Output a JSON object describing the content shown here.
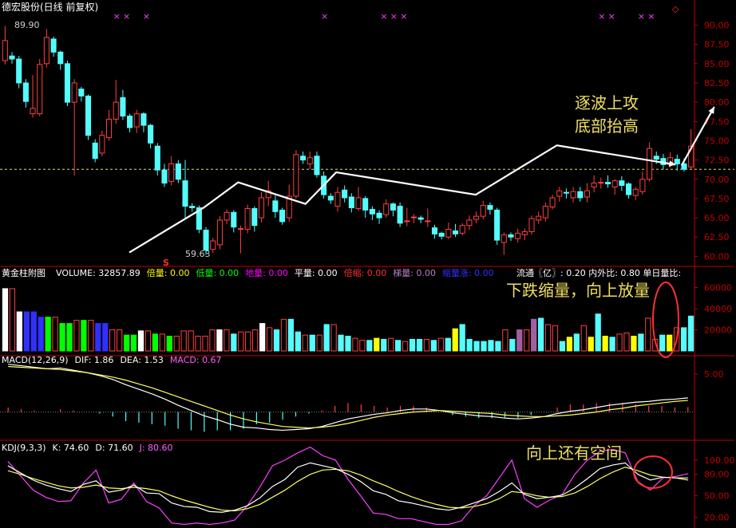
{
  "header": {
    "main_title": "德宏股份(日线 前复权)",
    "volume_title": "黄金柱附图",
    "volume_items": [
      {
        "label": "VOLUME:",
        "value": "32857.89",
        "color": "#ffffff"
      },
      {
        "label": "倍量:",
        "value": "0.00",
        "color": "#ffff00"
      },
      {
        "label": "低量:",
        "value": "0.00",
        "color": "#00ff00"
      },
      {
        "label": "地量:",
        "value": "0.00",
        "color": "#ff00ff"
      },
      {
        "label": "平量:",
        "value": "0.00",
        "color": "#ffffff"
      },
      {
        "label": "倍缩:",
        "value": "0.00",
        "color": "#ff3030"
      },
      {
        "label": "梯量:",
        "value": "0.00",
        "color": "#b080c0"
      },
      {
        "label": "缩量涨:",
        "value": "0.00",
        "color": "#3030ff"
      }
    ],
    "volume_right": "流通〖亿〗: 0.20  内外比: 0.80  单日量比:",
    "macd_items": [
      {
        "label": "MACD(12,26,9)",
        "value": "",
        "color": "#ffffff"
      },
      {
        "label": "DIF:",
        "value": "1.86",
        "color": "#ffffff"
      },
      {
        "label": "DEA:",
        "value": "1.53",
        "color": "#ffffff"
      },
      {
        "label": "MACD:",
        "value": "0.67",
        "color": "#ff60ff"
      }
    ],
    "kdj_items": [
      {
        "label": "KDJ(9,3,3)",
        "value": "",
        "color": "#ffffff"
      },
      {
        "label": "K:",
        "value": "74.60",
        "color": "#ffffff"
      },
      {
        "label": "D:",
        "value": "71.60",
        "color": "#ffffff"
      },
      {
        "label": "J:",
        "value": "80.60",
        "color": "#ff60ff"
      }
    ]
  },
  "annotations": {
    "line1": "逐波上攻",
    "line2": "底部抬高",
    "volume_note": "下跌缩量，向上放量",
    "kdj_note": "向上还有空间",
    "high_label": "89.90",
    "low_label": "59.63",
    "s_marker": "S",
    "x_marker": "×",
    "corner_marker": "◇"
  },
  "colors": {
    "up": "#ff4040",
    "down": "#54fcfc",
    "axis": "#c00000",
    "dashed_level": "#e0e060",
    "white": "#ffffff",
    "yellow": "#ffff00",
    "green": "#00ff00",
    "blue": "#3030ff",
    "purple": "#a060a0",
    "magenta": "#ff40ff",
    "circle": "#ff3030"
  },
  "chart_data": {
    "type": "candlestick",
    "price_axis": {
      "ticks": [
        "90.00",
        "87.50",
        "85.00",
        "82.50",
        "80.00",
        "77.50",
        "75.00",
        "72.50",
        "70.00",
        "67.50",
        "65.00",
        "62.50",
        "60.00"
      ],
      "ylim": [
        58.9,
        91.4
      ]
    },
    "volume_axis": {
      "ticks": [
        "60000",
        "40000",
        "20000"
      ],
      "ylim": [
        0,
        68000
      ]
    },
    "macd_axis": {
      "ticks": [
        "5.00"
      ],
      "ylim": [
        -3.3,
        7.0
      ]
    },
    "kdj_axis": {
      "ticks": [
        "100.00",
        "80.00",
        "50.00",
        "20.00"
      ],
      "ylim": [
        5,
        112
      ]
    },
    "dashed_level": 71.3,
    "x_marks": [
      11,
      12,
      14,
      32,
      38,
      39,
      40,
      60,
      61,
      64,
      65
    ],
    "candles": [
      [
        85.4,
        88.0,
        84.9,
        89.9,
        "up"
      ],
      [
        86.0,
        85.6,
        85.0,
        86.5,
        "down"
      ],
      [
        85.6,
        82.5,
        81.8,
        86.0,
        "down"
      ],
      [
        82.5,
        80.1,
        79.3,
        83.0,
        "down"
      ],
      [
        79.2,
        78.5,
        78.0,
        83.5,
        "up"
      ],
      [
        78.5,
        84.9,
        78.2,
        85.6,
        "up"
      ],
      [
        85.0,
        88.4,
        84.5,
        89.5,
        "up"
      ],
      [
        88.2,
        86.5,
        85.9,
        88.5,
        "down"
      ],
      [
        86.5,
        85.0,
        84.2,
        86.7,
        "down"
      ],
      [
        85.0,
        80.0,
        79.5,
        85.4,
        "down"
      ],
      [
        80.0,
        82.5,
        70.5,
        83.0,
        "up"
      ],
      [
        81.7,
        80.8,
        80.1,
        82.0,
        "down"
      ],
      [
        80.8,
        75.7,
        75.1,
        81.0,
        "down"
      ],
      [
        74.7,
        72.7,
        72.2,
        75.2,
        "down"
      ],
      [
        73.4,
        75.7,
        73.0,
        76.3,
        "up"
      ],
      [
        75.4,
        77.8,
        75.0,
        79.0,
        "up"
      ],
      [
        77.8,
        80.0,
        77.2,
        82.9,
        "up"
      ],
      [
        80.6,
        78.2,
        77.7,
        81.6,
        "down"
      ],
      [
        78.2,
        76.7,
        76.1,
        78.5,
        "down"
      ],
      [
        76.8,
        78.5,
        76.0,
        79.0,
        "up"
      ],
      [
        78.5,
        77.0,
        76.1,
        78.7,
        "down"
      ],
      [
        77.0,
        74.7,
        74.0,
        77.2,
        "down"
      ],
      [
        74.3,
        71.2,
        70.5,
        74.7,
        "down"
      ],
      [
        71.2,
        69.5,
        69.0,
        72.0,
        "down"
      ],
      [
        69.7,
        72.0,
        69.2,
        73.0,
        "up"
      ],
      [
        72.0,
        70.0,
        69.5,
        72.5,
        "down"
      ],
      [
        69.8,
        66.5,
        65.0,
        72.5,
        "down"
      ],
      [
        66.5,
        66.3,
        65.8,
        66.9,
        "down"
      ],
      [
        66.3,
        63.5,
        63.0,
        66.6,
        "down"
      ],
      [
        63.4,
        60.8,
        60.2,
        63.8,
        "down"
      ],
      [
        60.9,
        62.0,
        60.4,
        62.4,
        "up"
      ],
      [
        61.5,
        64.7,
        60.9,
        65.2,
        "up"
      ],
      [
        64.7,
        65.7,
        64.2,
        66.1,
        "up"
      ],
      [
        65.7,
        63.8,
        63.1,
        66.0,
        "down"
      ],
      [
        63.6,
        63.6,
        60.4,
        64.0,
        "up"
      ],
      [
        63.5,
        66.2,
        63.0,
        66.7,
        "up"
      ],
      [
        66.2,
        64.0,
        63.2,
        66.5,
        "down"
      ],
      [
        65.0,
        67.6,
        64.4,
        68.3,
        "up"
      ],
      [
        67.6,
        68.5,
        66.5,
        69.8,
        "up"
      ],
      [
        67.2,
        65.8,
        65.0,
        67.9,
        "down"
      ],
      [
        66.0,
        64.5,
        64.1,
        66.3,
        "down"
      ],
      [
        65.0,
        67.8,
        64.5,
        69.3,
        "up"
      ],
      [
        67.8,
        73.2,
        67.5,
        73.8,
        "up"
      ],
      [
        73.0,
        72.5,
        72.0,
        73.6,
        "down"
      ],
      [
        72.0,
        72.8,
        71.3,
        73.6,
        "up"
      ],
      [
        73.0,
        70.6,
        70.2,
        73.6,
        "down"
      ],
      [
        70.4,
        68.0,
        67.5,
        71.0,
        "down"
      ],
      [
        67.8,
        67.3,
        66.8,
        68.2,
        "down"
      ],
      [
        66.5,
        68.3,
        65.8,
        69.0,
        "up"
      ],
      [
        68.6,
        67.6,
        67.0,
        69.2,
        "down"
      ],
      [
        67.7,
        66.3,
        65.7,
        68.2,
        "down"
      ],
      [
        66.2,
        67.6,
        65.9,
        69.0,
        "up"
      ],
      [
        67.5,
        66.0,
        65.0,
        67.8,
        "down"
      ],
      [
        66.1,
        65.5,
        64.7,
        66.5,
        "down"
      ],
      [
        65.6,
        65.0,
        64.2,
        66.0,
        "down"
      ],
      [
        65.4,
        66.8,
        65.0,
        67.4,
        "up"
      ],
      [
        66.8,
        66.0,
        65.2,
        67.0,
        "down"
      ],
      [
        66.5,
        64.3,
        63.8,
        67.0,
        "down"
      ],
      [
        64.6,
        64.6,
        63.9,
        66.3,
        "up"
      ],
      [
        65.0,
        65.1,
        64.3,
        65.5,
        "up"
      ],
      [
        65.0,
        64.8,
        64.3,
        65.3,
        "down"
      ],
      [
        64.6,
        64.6,
        63.8,
        66.2,
        "up"
      ],
      [
        63.7,
        62.9,
        62.3,
        64.1,
        "down"
      ],
      [
        63.0,
        62.6,
        62.2,
        63.2,
        "down"
      ],
      [
        62.5,
        63.5,
        62.2,
        64.4,
        "up"
      ],
      [
        63.3,
        62.9,
        62.5,
        64.2,
        "down"
      ],
      [
        63.0,
        64.0,
        62.7,
        64.3,
        "up"
      ],
      [
        64.0,
        64.7,
        63.4,
        65.3,
        "up"
      ],
      [
        64.8,
        65.2,
        64.3,
        65.8,
        "up"
      ],
      [
        65.2,
        66.6,
        64.8,
        67.2,
        "up"
      ],
      [
        66.6,
        66.1,
        65.4,
        67.0,
        "down"
      ],
      [
        66.0,
        62.1,
        61.5,
        66.3,
        "down"
      ],
      [
        61.8,
        62.8,
        60.2,
        63.1,
        "up"
      ],
      [
        62.8,
        62.5,
        62.0,
        63.1,
        "down"
      ],
      [
        62.3,
        63.0,
        61.8,
        63.6,
        "up"
      ],
      [
        62.8,
        63.2,
        62.1,
        63.6,
        "up"
      ],
      [
        63.2,
        64.9,
        62.8,
        65.3,
        "up"
      ],
      [
        64.7,
        65.2,
        64.2,
        65.8,
        "up"
      ],
      [
        65.0,
        66.5,
        64.5,
        67.0,
        "up"
      ],
      [
        66.4,
        67.6,
        66.1,
        68.0,
        "up"
      ],
      [
        67.8,
        68.5,
        67.1,
        69.0,
        "up"
      ],
      [
        68.3,
        68.2,
        67.5,
        68.8,
        "down"
      ],
      [
        67.6,
        68.4,
        67.0,
        69.0,
        "up"
      ],
      [
        68.4,
        67.6,
        67.1,
        69.0,
        "down"
      ],
      [
        67.7,
        68.5,
        67.0,
        69.5,
        "up"
      ],
      [
        69.0,
        69.5,
        68.3,
        70.5,
        "up"
      ],
      [
        69.5,
        69.6,
        68.8,
        70.2,
        "up"
      ],
      [
        69.6,
        69.4,
        68.9,
        70.5,
        "down"
      ],
      [
        69.0,
        69.8,
        68.0,
        70.0,
        "up"
      ],
      [
        69.8,
        69.2,
        68.5,
        70.4,
        "down"
      ],
      [
        69.4,
        68.0,
        67.5,
        69.6,
        "down"
      ],
      [
        67.9,
        68.7,
        67.3,
        69.0,
        "up"
      ],
      [
        68.4,
        70.0,
        68.0,
        71.0,
        "up"
      ],
      [
        70.0,
        74.0,
        69.7,
        74.8,
        "up"
      ],
      [
        73.0,
        72.6,
        72.0,
        73.6,
        "down"
      ],
      [
        72.7,
        71.9,
        71.3,
        73.3,
        "down"
      ],
      [
        71.9,
        72.8,
        71.5,
        73.5,
        "up"
      ],
      [
        72.6,
        72.0,
        71.1,
        73.2,
        "down"
      ],
      [
        72.0,
        71.3,
        71.0,
        72.7,
        "down"
      ],
      [
        71.6,
        74.3,
        71.2,
        76.5,
        "up"
      ]
    ],
    "arrows": [
      [
        [
          12.4,
          60.5
        ],
        [
          19.9,
          66.3
        ],
        [
          23.4,
          69.6
        ],
        [
          30.2,
          66.8
        ],
        [
          33.3,
          70.9
        ],
        [
          47.4,
          68.0
        ],
        [
          55.6,
          74.4
        ],
        [
          67.6,
          71.9
        ]
      ],
      [
        [
          68.2,
          71.8
        ],
        [
          71.5,
          79.4
        ]
      ]
    ],
    "volume": {
      "values": [
        59000,
        59000,
        37000,
        37000,
        37000,
        32000,
        32000,
        32000,
        26000,
        26000,
        29000,
        29000,
        29000,
        26000,
        26000,
        20000,
        20000,
        15000,
        15000,
        19000,
        19000,
        16000,
        16000,
        14000,
        14000,
        19000,
        19000,
        14000,
        14000,
        20000,
        20000,
        20000,
        16000,
        18000,
        18000,
        20000,
        26000,
        22000,
        20000,
        30000,
        30000,
        18000,
        15000,
        15000,
        15000,
        25000,
        25000,
        15000,
        14000,
        12000,
        10000,
        10000,
        12000,
        11000,
        12000,
        10000,
        9000,
        11000,
        11000,
        11000,
        10000,
        12000,
        12000,
        21000,
        25000,
        11000,
        9000,
        9000,
        10000,
        9000,
        20000,
        11000,
        20000,
        20000,
        30000,
        31000,
        25000,
        24000,
        9000,
        13000,
        16000,
        24000,
        13000,
        35000,
        14000,
        13000,
        16000,
        17000,
        14000,
        16000,
        31000,
        11000,
        15000,
        15000,
        22000,
        22000,
        33000
      ],
      "colors": [
        "white",
        "red",
        "white",
        "blue",
        "blue",
        "blue",
        "green",
        "red",
        "green",
        "green",
        "red",
        "green",
        "red",
        "blue",
        "blue",
        "red",
        "red",
        "green",
        "green",
        "white",
        "red",
        "green",
        "red",
        "green",
        "red",
        "red",
        "red",
        "red",
        "red",
        "red",
        "white",
        "red",
        "cyan",
        "red",
        "red",
        "red",
        "white",
        "red",
        "cyan",
        "red",
        "cyan",
        "cyan",
        "red",
        "cyan",
        "red",
        "cyan",
        "red",
        "cyan",
        "cyan",
        "red",
        "red",
        "cyan",
        "yellow",
        "cyan",
        "red",
        "cyan",
        "red",
        "cyan",
        "cyan",
        "red",
        "cyan",
        "red",
        "cyan",
        "yellow",
        "cyan",
        "cyan",
        "cyan",
        "cyan",
        "cyan",
        "cyan",
        "red",
        "cyan",
        "purple",
        "red",
        "purple",
        "cyan",
        "red",
        "red",
        "cyan",
        "yellow",
        "cyan",
        "red",
        "yellow",
        "cyan",
        "yellow",
        "cyan",
        "red",
        "red",
        "yellow",
        "cyan",
        "red",
        "red",
        "cyan",
        "yellow",
        "red",
        "cyan",
        "cyan"
      ]
    },
    "macd": {
      "dif": [
        6.3,
        6.1,
        5.9,
        5.7,
        5.8,
        5.5,
        5.2,
        4.8,
        4.3,
        3.6,
        3.0,
        2.4,
        1.7,
        0.9,
        0.2,
        -0.5,
        -1.0,
        -1.6,
        -2.0,
        -2.1,
        -2.3,
        -2.4,
        -2.3,
        -2.2,
        -1.9,
        -1.4,
        -0.9,
        -0.6,
        -0.3,
        -0.1,
        0.2,
        0.4,
        0.4,
        0.2,
        -0.1,
        -0.3,
        -0.5,
        -0.6,
        -0.8,
        -0.9,
        -0.8,
        -0.6,
        -0.2,
        0.1,
        0.3,
        0.6,
        0.9,
        1.1,
        1.3,
        1.4,
        1.6,
        1.7,
        1.86
      ],
      "dea": [
        6.0,
        5.9,
        5.8,
        5.7,
        5.6,
        5.4,
        5.2,
        4.9,
        4.6,
        4.2,
        3.7,
        3.2,
        2.6,
        2.0,
        1.4,
        0.8,
        0.2,
        -0.4,
        -0.9,
        -1.3,
        -1.6,
        -1.9,
        -2.0,
        -2.1,
        -2.0,
        -1.8,
        -1.5,
        -1.1,
        -0.7,
        -0.4,
        -0.2,
        0.0,
        0.1,
        0.2,
        0.1,
        0.0,
        -0.1,
        -0.2,
        -0.4,
        -0.5,
        -0.6,
        -0.6,
        -0.5,
        -0.4,
        -0.2,
        0.0,
        0.3,
        0.5,
        0.8,
        1.0,
        1.2,
        1.4,
        1.53
      ]
    },
    "kdj": {
      "k": [
        92,
        82,
        72,
        65,
        60,
        56,
        66,
        71,
        55,
        58,
        65,
        54,
        53,
        40,
        35,
        34,
        28,
        27,
        30,
        36,
        47,
        63,
        73,
        90,
        96,
        92,
        88,
        80,
        70,
        57,
        52,
        43,
        40,
        36,
        32,
        30,
        34,
        40,
        46,
        56,
        68,
        52,
        46,
        48,
        51,
        61,
        74,
        88,
        93,
        96,
        80,
        72,
        76,
        75,
        75
      ],
      "d": [
        85,
        80,
        74,
        69,
        64,
        61,
        62,
        65,
        61,
        60,
        62,
        60,
        57,
        50,
        44,
        39,
        34,
        30,
        29,
        32,
        38,
        48,
        58,
        70,
        80,
        86,
        87,
        85,
        79,
        71,
        64,
        56,
        49,
        43,
        38,
        34,
        33,
        35,
        39,
        46,
        56,
        54,
        50,
        48,
        49,
        54,
        63,
        74,
        83,
        90,
        85,
        79,
        76,
        75,
        72
      ],
      "j": [
        98,
        78,
        58,
        48,
        42,
        43,
        68,
        86,
        40,
        45,
        68,
        42,
        33,
        12,
        10,
        12,
        10,
        12,
        16,
        36,
        62,
        92,
        100,
        110,
        118,
        106,
        100,
        73,
        50,
        26,
        24,
        18,
        18,
        14,
        10,
        10,
        15,
        36,
        50,
        75,
        100,
        46,
        34,
        44,
        52,
        80,
        100,
        112,
        115,
        110,
        70,
        58,
        75,
        77,
        81
      ]
    }
  }
}
